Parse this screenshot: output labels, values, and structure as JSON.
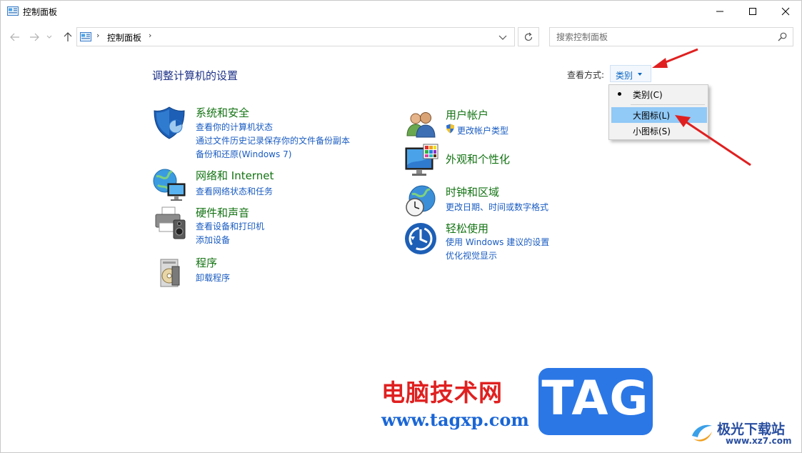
{
  "window": {
    "title": "控制面板"
  },
  "address_bar": {
    "path": "控制面板"
  },
  "search": {
    "placeholder": "搜索控制面板"
  },
  "page_title": "调整计算机的设置",
  "view_by": {
    "label": "查看方式:",
    "selected": "类别",
    "menu": [
      {
        "label": "类别(C)",
        "checked": true
      },
      {
        "label": "大图标(L)",
        "highlighted": true
      },
      {
        "label": "小图标(S)"
      }
    ]
  },
  "categories_left": [
    {
      "title": "系统和安全",
      "icon": "shield-icon",
      "links": [
        "查看你的计算机状态",
        "通过文件历史记录保存你的文件备份副本",
        "备份和还原(Windows 7)"
      ]
    },
    {
      "title": "网络和 Internet",
      "icon": "network-globe-icon",
      "links": [
        "查看网络状态和任务"
      ]
    },
    {
      "title": "硬件和声音",
      "icon": "printer-speaker-icon",
      "links": [
        "查看设备和打印机",
        "添加设备"
      ]
    },
    {
      "title": "程序",
      "icon": "programs-disc-icon",
      "links": [
        "卸载程序"
      ]
    }
  ],
  "categories_right": [
    {
      "title": "用户帐户",
      "icon": "users-icon",
      "links": [
        "更改帐户类型"
      ]
    },
    {
      "title": "外观和个性化",
      "icon": "monitor-palette-icon",
      "links": []
    },
    {
      "title": "时钟和区域",
      "icon": "clock-globe-icon",
      "links": [
        "更改日期、时间或数字格式"
      ]
    },
    {
      "title": "轻松使用",
      "icon": "ease-of-access-icon",
      "links": [
        "使用 Windows 建议的设置",
        "优化视觉显示"
      ]
    }
  ],
  "watermark": {
    "cn_text": "电脑技术网",
    "url": "www.tagxp.com",
    "tag": "TAG",
    "site_cn": "极光下载站",
    "site_url": "www.xz7.com"
  },
  "colors": {
    "link": "#1a5cc2",
    "category_title": "#137313",
    "page_title": "#1e3287",
    "menu_highlight": "#91c9f7",
    "annotation_arrow": "#e02020"
  }
}
